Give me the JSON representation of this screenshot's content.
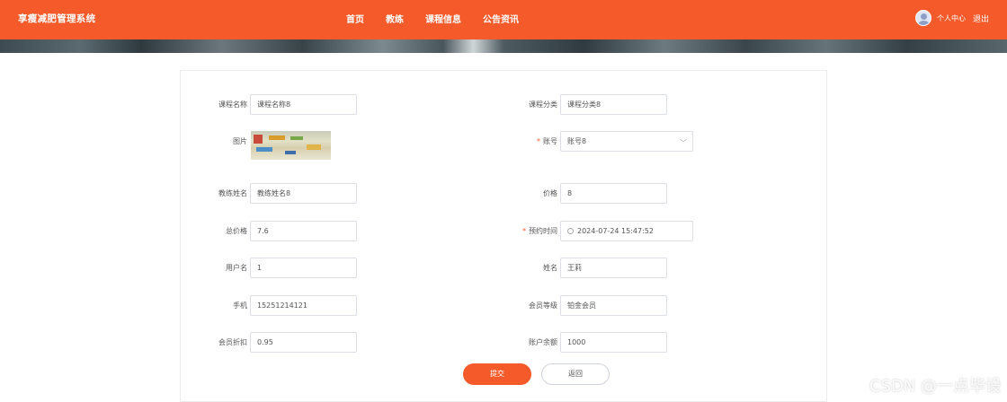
{
  "header": {
    "brand": "享瘦减肥管理系统",
    "nav": [
      "首页",
      "教练",
      "课程信息",
      "公告资讯"
    ],
    "user_center": "个人中心",
    "logout": "退出"
  },
  "form": {
    "course_name": {
      "label": "课程名称",
      "value": "课程名称8"
    },
    "course_category": {
      "label": "课程分类",
      "value": "课程分类8"
    },
    "picture": {
      "label": "图片"
    },
    "account": {
      "label": "账号",
      "value": "账号8",
      "required": true
    },
    "coach_name": {
      "label": "教练姓名",
      "value": "教练姓名8"
    },
    "price": {
      "label": "价格",
      "value": "8"
    },
    "total_price": {
      "label": "总价格",
      "value": "7.6"
    },
    "booking_time": {
      "label": "预约时间",
      "value": "2024-07-24 15:47:52",
      "required": true
    },
    "username": {
      "label": "用户名",
      "value": "1"
    },
    "name": {
      "label": "姓名",
      "value": "王莉"
    },
    "phone": {
      "label": "手机",
      "value": "15251214121"
    },
    "member_level": {
      "label": "会员等级",
      "value": "铂金会员"
    },
    "member_discount": {
      "label": "会员折扣",
      "value": "0.95"
    },
    "account_balance": {
      "label": "账户余额",
      "value": "1000"
    }
  },
  "buttons": {
    "submit": "提交",
    "back": "返回"
  },
  "watermark": "CSDN @一点毕设",
  "colors": {
    "accent": "#f45a2a",
    "required": "#f45a2a"
  }
}
